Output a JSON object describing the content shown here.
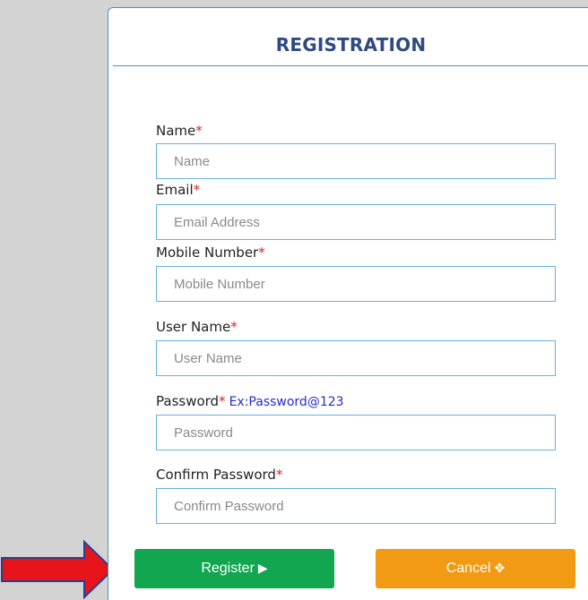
{
  "form": {
    "title": "REGISTRATION",
    "required_marker": "*",
    "fields": [
      {
        "label": "Name",
        "placeholder": "Name",
        "value": ""
      },
      {
        "label": "Email",
        "placeholder": "Email Address",
        "value": ""
      },
      {
        "label": "Mobile Number",
        "placeholder": "Mobile Number",
        "value": ""
      },
      {
        "label": "User Name",
        "placeholder": "User Name",
        "value": ""
      },
      {
        "label": "Password",
        "placeholder": "Password",
        "value": "",
        "hint": "Ex:Password@123"
      },
      {
        "label": "Confirm Password",
        "placeholder": "Confirm Password",
        "value": ""
      }
    ],
    "register_label": "Register",
    "register_icon_glyph": "▶",
    "cancel_label": "Cancel",
    "cancel_icon_glyph": "✥"
  },
  "icons": {
    "register": "play-icon",
    "cancel": "move-icon",
    "pointer": "red-arrow-icon"
  },
  "colors": {
    "background": "#d3d3d3",
    "panel_border": "#4a90c8",
    "title": "#2f4a80",
    "required": "#e02020",
    "hint": "#2a2ad0",
    "input_border": "#66b3e0",
    "register_button": "#12a650",
    "cancel_button": "#f29a14",
    "arrow_fill": "#e8141c",
    "arrow_stroke": "#2a3f8c"
  }
}
